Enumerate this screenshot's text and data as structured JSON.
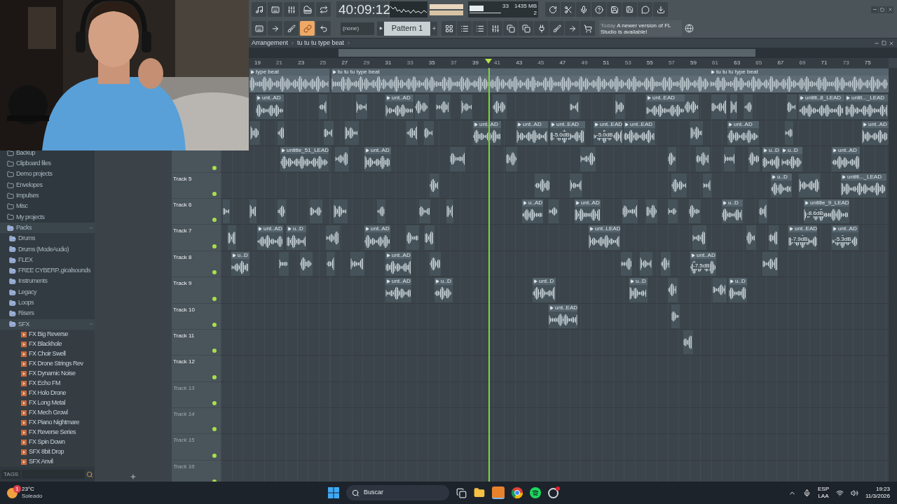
{
  "toolbar": {
    "time": "40:09:12",
    "cpu": "33",
    "memory": "1435 MB",
    "polyphony": "2",
    "pattern_none": "(none)",
    "pattern": "Pattern 1",
    "link_on": true,
    "hint_day": "Today",
    "hint": "A newer version of FL Studio is available!"
  },
  "arrangement": {
    "breadcrumb": [
      "Arrangement",
      "tu tu tu type beat"
    ],
    "ruler": [
      "19",
      "21",
      "23",
      "25",
      "27",
      "29",
      "31",
      "33",
      "35",
      "37",
      "39",
      "41",
      "43",
      "45",
      "47",
      "49",
      "51",
      "53",
      "55",
      "57",
      "59",
      "61",
      "63",
      "65",
      "67",
      "69",
      "71",
      "73",
      "75"
    ]
  },
  "browser": {
    "items": [
      {
        "label": "Backup",
        "kind": "folder"
      },
      {
        "label": "Clipboard files",
        "kind": "folder"
      },
      {
        "label": "Demo projects",
        "kind": "folder"
      },
      {
        "label": "Envelopes",
        "kind": "folder"
      },
      {
        "label": "Impulses",
        "kind": "folder"
      },
      {
        "label": "Misc",
        "kind": "folder"
      },
      {
        "label": "My projects",
        "kind": "folder"
      },
      {
        "label": "Packs",
        "kind": "pack",
        "expanded": true,
        "children": [
          {
            "label": "Drums",
            "kind": "pack"
          },
          {
            "label": "Drums (ModeAudio)",
            "kind": "pack"
          },
          {
            "label": "FLEX",
            "kind": "pack"
          },
          {
            "label": "FREE CYBERP..gicalsounds",
            "kind": "pack"
          },
          {
            "label": "Instruments",
            "kind": "pack"
          },
          {
            "label": "Legacy",
            "kind": "pack"
          },
          {
            "label": "Loops",
            "kind": "pack"
          },
          {
            "label": "Risers",
            "kind": "pack"
          },
          {
            "label": "SFX",
            "kind": "pack",
            "expanded": true,
            "children": [
              {
                "label": "FX Big Reverse",
                "kind": "sample"
              },
              {
                "label": "FX Blackhole",
                "kind": "sample"
              },
              {
                "label": "FX Choir Swell",
                "kind": "sample"
              },
              {
                "label": "FX Drone Strings Rev",
                "kind": "sample"
              },
              {
                "label": "FX Dynamic Noise",
                "kind": "sample"
              },
              {
                "label": "FX Echo FM",
                "kind": "sample"
              },
              {
                "label": "FX Holo Drone",
                "kind": "sample"
              },
              {
                "label": "FX Long Metal",
                "kind": "sample"
              },
              {
                "label": "FX Mech Growl",
                "kind": "sample"
              },
              {
                "label": "FX Piano Nightmare",
                "kind": "sample"
              },
              {
                "label": "FX Reverse Series",
                "kind": "sample"
              },
              {
                "label": "FX Spin Down",
                "kind": "sample"
              },
              {
                "label": "SFX 8bit Drop",
                "kind": "sample"
              },
              {
                "label": "SFX Anvil",
                "kind": "sample"
              }
            ]
          }
        ]
      }
    ],
    "tags_label": "TAGS"
  },
  "tracks": [
    {
      "clips": [
        {
          "label": "type beat"
        },
        {
          "label": "tu tu tu type beat"
        },
        {
          "label": "tu tu tu type beat"
        }
      ]
    },
    {
      "clips": [
        {
          "label": "unt..AD"
        },
        {
          "label": "unt..AD"
        },
        {
          "label": "unt..EAD"
        },
        {
          "label": "untitl..8_LEAD"
        },
        {
          "label": "untit..._LEAD"
        }
      ]
    },
    {
      "clips": [
        {
          "label": "unt..AD"
        },
        {
          "label": "unt..AD"
        },
        {
          "label": "unt..EAD",
          "gain": "-5.0dB"
        },
        {
          "label": "unt..EAD",
          "gain": "-5.0dB"
        },
        {
          "label": "unt..EAD"
        },
        {
          "label": "unt..AD"
        },
        {
          "label": "unt..AD"
        }
      ]
    },
    {
      "clips": [
        {
          "label": "untitle_51_LEAD"
        },
        {
          "label": "unt..AD"
        },
        {
          "label": "u..D"
        },
        {
          "label": "u..D"
        },
        {
          "label": "unt..AD"
        }
      ]
    },
    {
      "name": "Track 5",
      "dimmed": false,
      "clips": [
        {
          "label": "u..D"
        },
        {
          "label": "untitl..._LEAD"
        }
      ]
    },
    {
      "name": "Track 6",
      "dimmed": false,
      "clips": [
        {
          "label": "u..AD"
        },
        {
          "label": "unt..AD"
        },
        {
          "label": "u..D"
        },
        {
          "label": "untitle_9_LEAD",
          "gain": "-8.6dB"
        }
      ]
    },
    {
      "name": "Track 7",
      "dimmed": false,
      "clips": [
        {
          "label": "unt..AD"
        },
        {
          "label": "u..D"
        },
        {
          "label": "unt..AD"
        },
        {
          "label": "unt..LEAD"
        },
        {
          "label": "unt..EAD",
          "gain": "-7.9dB"
        },
        {
          "label": "unt..AD",
          "gain": "-5.3dB"
        }
      ]
    },
    {
      "name": "Track 8",
      "dimmed": false,
      "clips": [
        {
          "label": "u..D"
        },
        {
          "label": "unt..AD"
        },
        {
          "label": "unt..AD",
          "gain": "-7.5dB"
        }
      ]
    },
    {
      "name": "Track 9",
      "dimmed": false,
      "clips": [
        {
          "label": "unt..AD"
        },
        {
          "label": "u..D"
        },
        {
          "label": "unt..D"
        },
        {
          "label": "u..D"
        },
        {
          "label": "u..D"
        }
      ]
    },
    {
      "name": "Track 10",
      "dimmed": false,
      "clips": [
        {
          "label": "unt..EAD"
        }
      ]
    },
    {
      "name": "Track 11",
      "dimmed": false
    },
    {
      "name": "Track 12",
      "dimmed": false
    },
    {
      "name": "Track 13",
      "dimmed": true
    },
    {
      "name": "Track 14",
      "dimmed": true
    },
    {
      "name": "Track 15",
      "dimmed": true
    },
    {
      "name": "Track 16",
      "dimmed": true
    }
  ],
  "taskbar": {
    "badge": "1",
    "temperature": "23°C",
    "weather": "Soleado",
    "search": "Buscar",
    "language": "ESP",
    "layout": "LAA",
    "time": "19:23",
    "date": "11/3/2026"
  }
}
